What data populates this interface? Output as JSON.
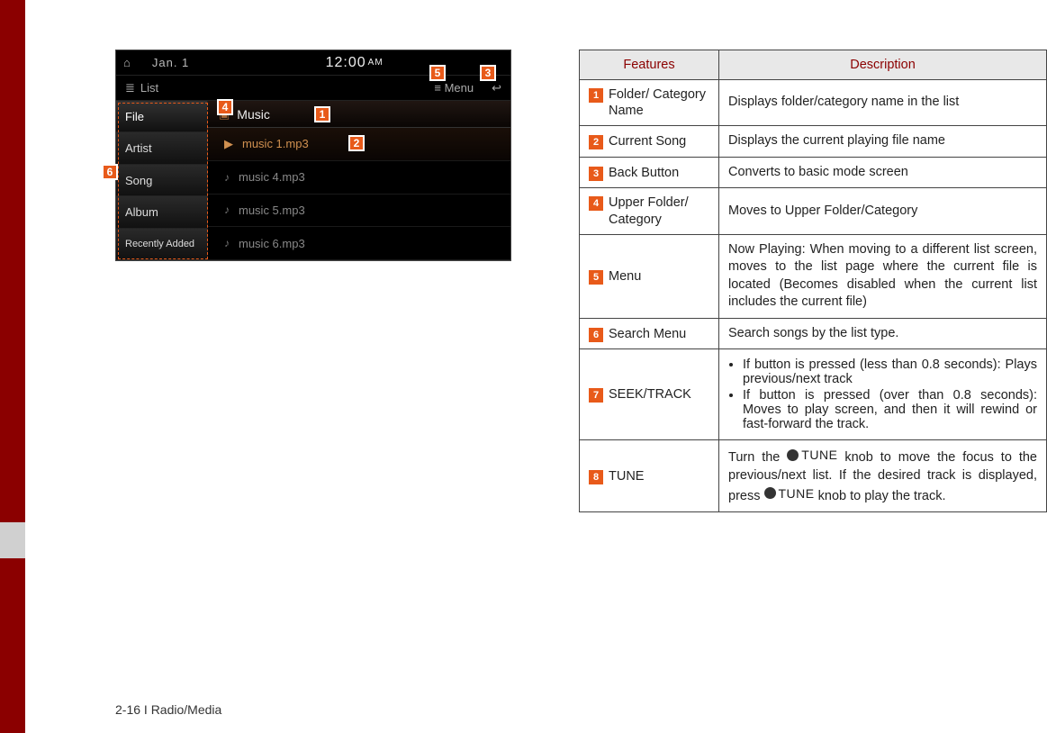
{
  "page_footer": "2-16 I Radio/Media",
  "screenshot": {
    "date": "Jan. 1",
    "time": "12:00",
    "ampm": "AM",
    "listLabel": "List",
    "menuLabel": "Menu",
    "leftMenu": [
      "File",
      "Artist",
      "Song",
      "Album",
      "Recently Added"
    ],
    "headerLabel": "Music",
    "rows": [
      {
        "name": "music 1.mp3",
        "current": true
      },
      {
        "name": "music 4.mp3",
        "current": false
      },
      {
        "name": "music 5.mp3",
        "current": false
      },
      {
        "name": "music 6.mp3",
        "current": false
      }
    ]
  },
  "callouts": {
    "c1": "1",
    "c2": "2",
    "c3": "3",
    "c4": "4",
    "c5": "5",
    "c6": "6"
  },
  "table": {
    "head": {
      "features": "Features",
      "description": "Description"
    },
    "rows": [
      {
        "num": "1",
        "feat": "Folder/\nCategory Name",
        "descText": "Displays folder/category name in the list"
      },
      {
        "num": "2",
        "feat": "Current Song",
        "descText": "Displays the current playing file name"
      },
      {
        "num": "3",
        "feat": "Back Button",
        "descText": "Converts to basic mode screen"
      },
      {
        "num": "4",
        "feat": "Upper Folder/\nCategory",
        "descText": "Moves to Upper Folder/Category"
      },
      {
        "num": "5",
        "feat": "Menu",
        "descText": "Now Playing: When moving to a different list screen, moves to the list page where the current file is located (Becomes disabled when the current list includes the current file)"
      },
      {
        "num": "6",
        "feat": "Search Menu",
        "descText": "Search songs by the list type."
      },
      {
        "num": "7",
        "feat": "SEEK/TRACK",
        "descList": [
          "If button is pressed (less than 0.8 seconds): Plays previous/next track",
          "If button is pressed (over than 0.8 seconds): Moves to play screen, and then it will rewind or fast-forward the track."
        ]
      },
      {
        "num": "8",
        "feat": "TUNE",
        "tune": {
          "pre": "Turn the ",
          "knob": "TUNE",
          "mid": " knob to move the focus to the previous/next list. If the desired track is displayed, press ",
          "post": " knob to play the track."
        }
      }
    ]
  }
}
